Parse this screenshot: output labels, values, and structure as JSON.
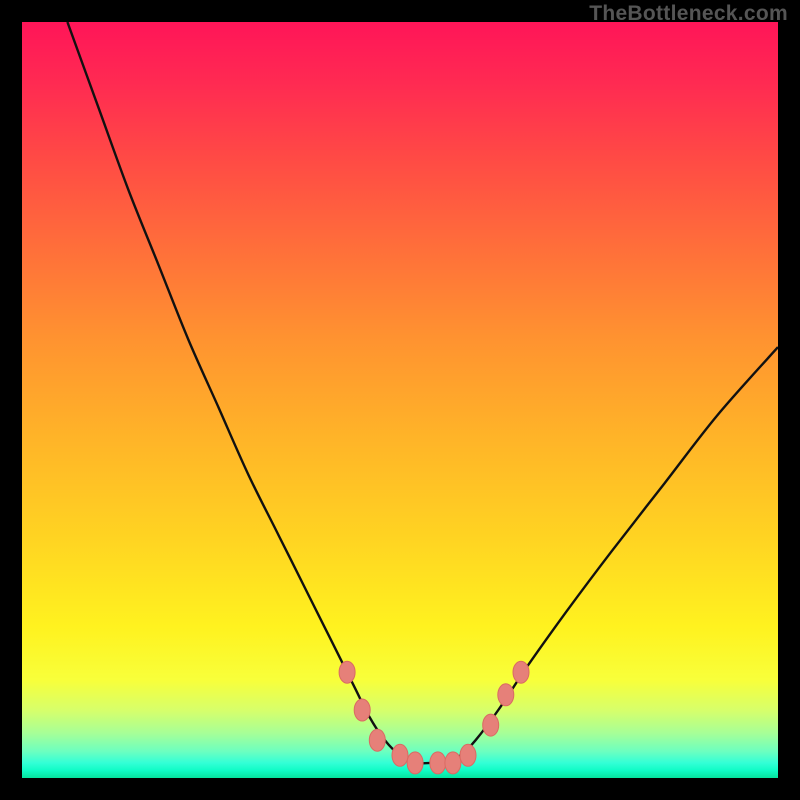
{
  "watermark": "TheBottleneck.com",
  "colors": {
    "frame": "#000000",
    "curve_stroke": "#111111",
    "marker_fill": "#e68079",
    "marker_stroke": "#da6a63"
  },
  "chart_data": {
    "type": "line",
    "title": "",
    "xlabel": "",
    "ylabel": "",
    "xlim": [
      0,
      100
    ],
    "ylim": [
      0,
      100
    ],
    "series": [
      {
        "name": "curve",
        "x": [
          6,
          10,
          14,
          18,
          22,
          26,
          30,
          34,
          38,
          41,
          44,
          46,
          48,
          50,
          52,
          54,
          56,
          58,
          60,
          63,
          67,
          72,
          78,
          85,
          92,
          100
        ],
        "y": [
          100,
          89,
          78,
          68,
          58,
          49,
          40,
          32,
          24,
          18,
          12,
          8,
          5,
          3,
          2,
          2,
          2,
          3,
          5,
          9,
          15,
          22,
          30,
          39,
          48,
          57
        ]
      }
    ],
    "markers": [
      {
        "x": 43,
        "y": 14
      },
      {
        "x": 45,
        "y": 9
      },
      {
        "x": 47,
        "y": 5
      },
      {
        "x": 50,
        "y": 3
      },
      {
        "x": 52,
        "y": 2
      },
      {
        "x": 55,
        "y": 2
      },
      {
        "x": 57,
        "y": 2
      },
      {
        "x": 59,
        "y": 3
      },
      {
        "x": 62,
        "y": 7
      },
      {
        "x": 64,
        "y": 11
      },
      {
        "x": 66,
        "y": 14
      }
    ]
  }
}
